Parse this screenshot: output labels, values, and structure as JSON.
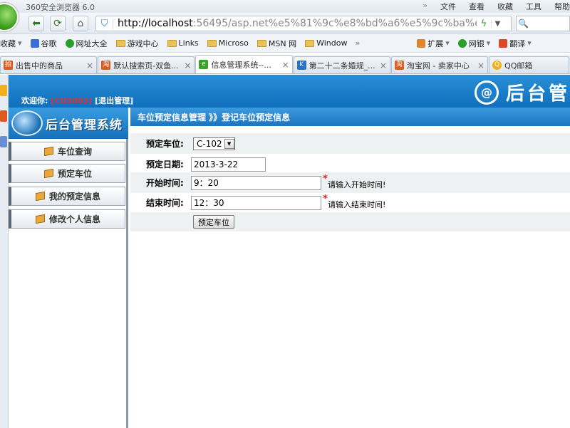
{
  "browser": {
    "title": "360安全浏览器 6.0",
    "menu": [
      "文件",
      "查看",
      "收藏",
      "工具",
      "帮助"
    ],
    "address_host": "http://localhost",
    "address_rest": ":56495/asp.net%e5%81%9c%e8%bd%a6%e5%9c%ba%e7%ae%",
    "bookmarks": [
      {
        "label": "收藏",
        "icon": "star-icon",
        "color": "#888888"
      },
      {
        "label": "谷歌",
        "icon": "google-icon",
        "color": "#3b6fd8"
      },
      {
        "label": "网址大全",
        "icon": "sites-icon",
        "color": "#2a9d2a"
      },
      {
        "label": "游戏中心",
        "icon": "folder-icon",
        "color": "#e8c25a"
      },
      {
        "label": "Links",
        "icon": "folder-icon",
        "color": "#e8c25a"
      },
      {
        "label": "Microso",
        "icon": "folder-icon",
        "color": "#e8c25a"
      },
      {
        "label": "MSN 网",
        "icon": "folder-icon",
        "color": "#e8c25a"
      },
      {
        "label": "Window",
        "icon": "folder-icon",
        "color": "#e8c25a"
      }
    ],
    "bookmarks_right": [
      "扩展",
      "网银",
      "翻译"
    ],
    "tabs": [
      {
        "label": "出售中的商品",
        "icon_color": "#e05a20",
        "active": false
      },
      {
        "label": "默认搜索页-双鱼...",
        "icon_color": "#e05a20",
        "active": false
      },
      {
        "label": "信息管理系统--...",
        "icon_color": "#3aa12a",
        "active": true
      },
      {
        "label": "第二十二条婚规_...",
        "icon_color": "#2a70c8",
        "active": false
      },
      {
        "label": "淘宝网 - 卖家中心",
        "icon_color": "#e05a20",
        "active": false
      },
      {
        "label": "QQ邮箱",
        "icon_color": "#f0b020",
        "active": false
      }
    ]
  },
  "header": {
    "welcome_prefix": "欢迎你:",
    "user_id": "[CUS003]",
    "logout": "[退出管理]",
    "logo_text": "后台管"
  },
  "sidebar": {
    "title": "后台管理系统",
    "items": [
      {
        "label": "车位查询"
      },
      {
        "label": "预定车位"
      },
      {
        "label": "我的预定信息"
      },
      {
        "label": "修改个人信息"
      }
    ]
  },
  "main": {
    "breadcrumb": "车位预定信息管理 》》登记车位预定信息",
    "form": {
      "space_label": "预定车位:",
      "space_value": "C-102",
      "date_label": "预定日期:",
      "date_value": "2013-3-22",
      "start_label": "开始时间:",
      "start_value": "9：20",
      "start_hint": "请输入开始时间!",
      "end_label": "结束时间:",
      "end_value": "12：30",
      "end_hint": "请输入结束时间!",
      "submit_label": "预定车位",
      "required_mark": "*"
    }
  },
  "colors": {
    "header_blue": "#1670bb",
    "required_red": "#e02020",
    "user_id_red": "#e03030"
  }
}
